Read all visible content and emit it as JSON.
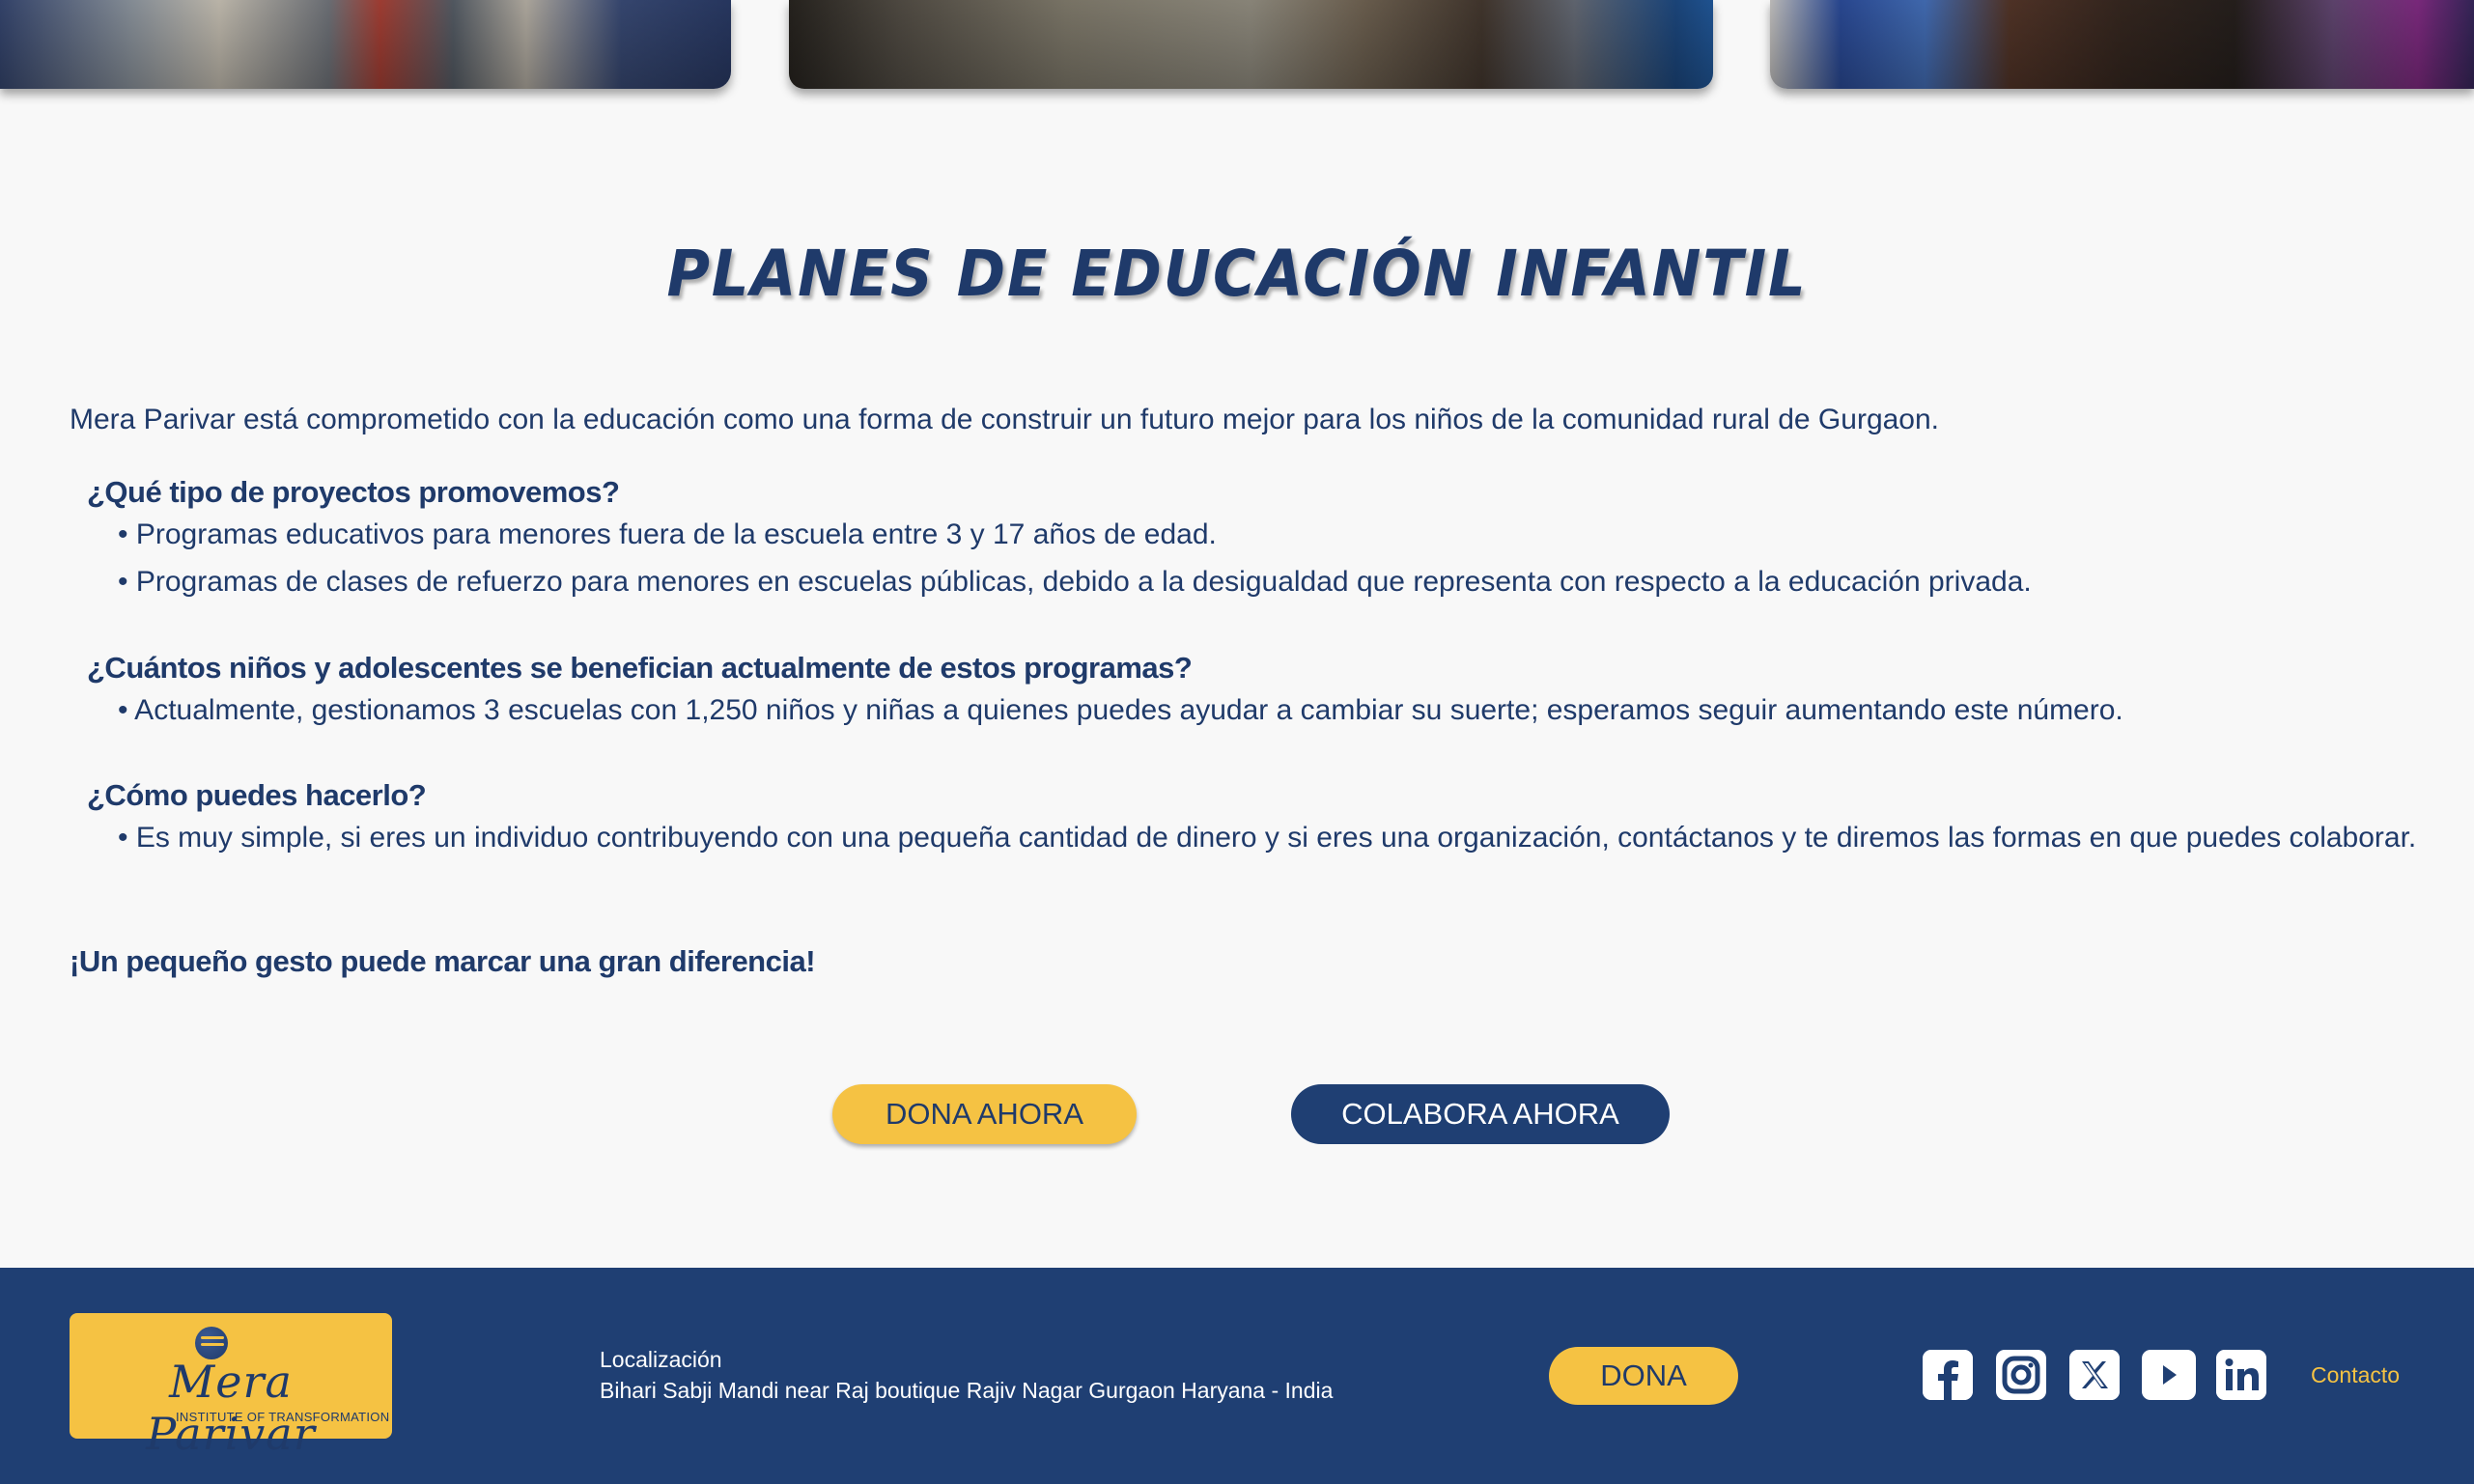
{
  "page": {
    "title": "PLANES DE EDUCACIÓN INFANTIL",
    "intro": "Mera Parivar está comprometido con la educación como una forma de construir un futuro mejor para los niños de la comunidad rural de Gurgaon.",
    "sections": [
      {
        "question": "¿Qué tipo de proyectos promovemos?",
        "bullets": [
          "• Programas educativos para menores fuera de la escuela entre 3 y 17 años de edad.",
          "• Programas de clases de refuerzo para menores en escuelas públicas, debido a la desigualdad que representa con respecto a la educación privada."
        ]
      },
      {
        "question": "¿Cuántos niños y adolescentes se benefician actualmente de estos programas?",
        "bullets": [
          "• Actualmente, gestionamos 3 escuelas con 1,250 niños y niñas a quienes puedes ayudar a cambiar su suerte; esperamos seguir aumentando este número."
        ]
      },
      {
        "question": "¿Cómo puedes hacerlo?",
        "bullets": [
          "• Es muy simple, si eres un individuo contribuyendo con una pequeña cantidad de dinero y si eres una organización, contáctanos y te diremos las formas en que puedes colaborar."
        ]
      }
    ],
    "closing": "¡Un pequeño gesto puede marcar una gran diferencia!",
    "buttons": {
      "donate": "DONA AHORA",
      "collaborate": "COLABORA AHORA"
    }
  },
  "footer": {
    "logo": {
      "brand": "Mera Parivar",
      "tagline": "INSTITUTE OF TRANSFORMATION"
    },
    "location_label": "Localización",
    "address": "Bihari Sabji Mandi near Raj boutique Rajiv Nagar Gurgaon Haryana - India",
    "donate_button": "DONA",
    "social": [
      "facebook-icon",
      "instagram-icon",
      "x-icon",
      "youtube-icon",
      "linkedin-icon"
    ],
    "contact_link": "Contacto"
  },
  "colors": {
    "navy": "#1f3f73",
    "yellow": "#f5c243",
    "background": "#f8f8f8",
    "text": "#1f3a6a"
  }
}
